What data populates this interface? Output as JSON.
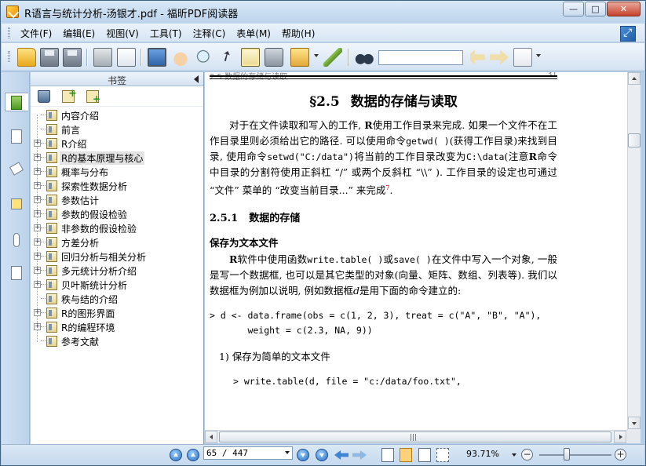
{
  "window": {
    "title": "R语言与统计分析-汤银才.pdf - 福昕PDF阅读器",
    "minimize": "—",
    "maximize": "□",
    "close": "✕"
  },
  "menu": {
    "items": [
      "文件(F)",
      "编辑(E)",
      "视图(V)",
      "工具(T)",
      "注释(C)",
      "表单(M)",
      "帮助(H)"
    ]
  },
  "toolbar": {
    "find_value": "",
    "icons": [
      "folder-icon",
      "save-icon",
      "save-as-icon",
      "print-icon",
      "email-icon",
      "fullscreen-icon",
      "hand-tool-icon",
      "zoom-tool-icon",
      "select-tool-icon",
      "text-select-icon",
      "snapshot-icon",
      "rms-icon",
      "sign-icon",
      "find-icon",
      "find-prev-icon",
      "find-next-icon",
      "find-options-icon"
    ]
  },
  "bookmarks": {
    "title": "书签",
    "items": [
      {
        "label": "内容介绍",
        "expandable": false
      },
      {
        "label": "前言",
        "expandable": false
      },
      {
        "label": "R介绍",
        "expandable": true
      },
      {
        "label": "R的基本原理与核心",
        "expandable": true,
        "selected": true
      },
      {
        "label": "概率与分布",
        "expandable": true
      },
      {
        "label": "探索性数据分析",
        "expandable": true
      },
      {
        "label": "参数估计",
        "expandable": true
      },
      {
        "label": "参数的假设检验",
        "expandable": true
      },
      {
        "label": "非参数的假设检验",
        "expandable": true
      },
      {
        "label": "方差分析",
        "expandable": true
      },
      {
        "label": "回归分析与相关分析",
        "expandable": true
      },
      {
        "label": "多元统计分析介绍",
        "expandable": true
      },
      {
        "label": "贝叶斯统计分析",
        "expandable": true
      },
      {
        "label": "秩与结的介绍",
        "expandable": false
      },
      {
        "label": "R的图形界面",
        "expandable": true
      },
      {
        "label": "R的编程环境",
        "expandable": true
      },
      {
        "label": "参考文献",
        "expandable": false
      }
    ]
  },
  "document": {
    "header_cut": "2.5 数据的存储与读取",
    "header_page_cut": "31",
    "section_num": "§2.5",
    "section_title": "数据的存储与读取",
    "para1_a": "对于在文件读取和写入的工作, ",
    "para1_b": "R",
    "para1_c": "使用工作目录来完成. 如果一个文件不在工作目录里则必须给出它的路径. 可以使用命令",
    "para1_code1": "getwd( )",
    "para1_d": "(获得工作目录)来找到目录, 使用命令",
    "para1_code2": "setwd(\"C:/data\")",
    "para1_e": "将当前的工作目录改变为",
    "para1_code3": "C:\\data",
    "para1_f": "(注意",
    "para1_g": "R",
    "para1_h": "命令中目录的分割符使用正斜杠 “/” 或两个反斜杠 “\\\\” ). 工作目录的设定也可通过 “文件” 菜单的 “改变当前目录...” 来完成",
    "para1_sup": "7",
    "para1_end": ".",
    "subsec_num": "2.5.1",
    "subsec_title": "数据的存储",
    "subsub_title": "保存为文本文件",
    "para2_a": "R",
    "para2_b": "软件中使用函数",
    "para2_code1": "write.table( )",
    "para2_c": "或",
    "para2_code2": "save( )",
    "para2_d": "在文件中写入一个对象, 一般是写一个数据框, 也可以是其它类型的对象(向量、矩阵、数组、列表等). 我们以数据框为例加以说明, 例如数据框",
    "para2_e": "d",
    "para2_f": "是用下面的命令建立的:",
    "code1": "> d <- data.frame(obs = c(1, 2, 3), treat = c(\"A\", \"B\", \"A\"),\n       weight = c(2.3, NA, 9))",
    "list1": "1)  保存为简单的文本文件",
    "code2": "> write.table(d, file = \"c:/data/foo.txt\","
  },
  "statusbar": {
    "page_value": "65 / 447",
    "zoom": "93.71%",
    "zoom_level_fraction": 0.38
  }
}
